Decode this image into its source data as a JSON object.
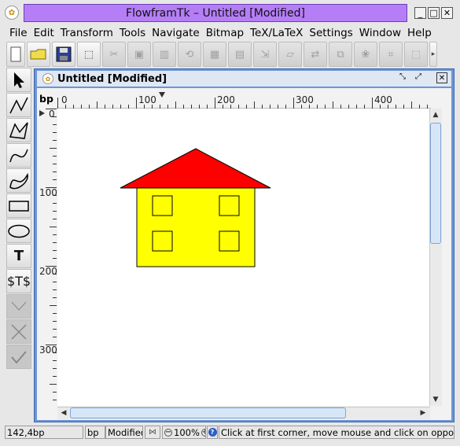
{
  "window": {
    "title": "FlowframTk – Untitled [Modified]",
    "accent": "#b57ef7"
  },
  "menu": [
    "File",
    "Edit",
    "Transform",
    "Tools",
    "Navigate",
    "Bitmap",
    "TeX/LaTeX",
    "Settings",
    "Window",
    "Help"
  ],
  "toolbar": {
    "buttons": [
      "new-icon",
      "open-icon",
      "save-icon",
      "select-all-icon",
      "cut-icon",
      "move-to-front-icon",
      "move-to-back-icon",
      "rotate-icon",
      "group-icon",
      "ungroup-icon",
      "scale-icon",
      "shear-icon",
      "reverse-icon",
      "merge-icon",
      "pattern-icon",
      "distort-icon",
      "rectangle-select-icon",
      "scroll-right-icon"
    ]
  },
  "tools": [
    "select-tool-icon",
    "open-line-icon",
    "closed-line-icon",
    "open-curve-icon",
    "closed-curve-icon",
    "rectangle-icon",
    "ellipse-icon",
    "text-icon",
    "math-text-icon",
    "gap-icon",
    "abandon-icon",
    "finish-icon"
  ],
  "tool_labels": {
    "text": "T",
    "math_text": "$T$"
  },
  "document": {
    "title": "Untitled [Modified]",
    "unit": "bp"
  },
  "ruler": {
    "h_labels": [
      "0",
      "100",
      "200",
      "300",
      "400"
    ],
    "v_labels": [
      "0",
      "100",
      "200",
      "300"
    ]
  },
  "drawing": {
    "roof_color": "#ff0000",
    "wall_color": "#ffff00",
    "outline_color": "#000000"
  },
  "status": {
    "position": "142,4bp",
    "unit": "bp",
    "modified": "Modified",
    "zoom": "100%",
    "message": "Click at first corner, move mouse and click on opposite corner"
  }
}
